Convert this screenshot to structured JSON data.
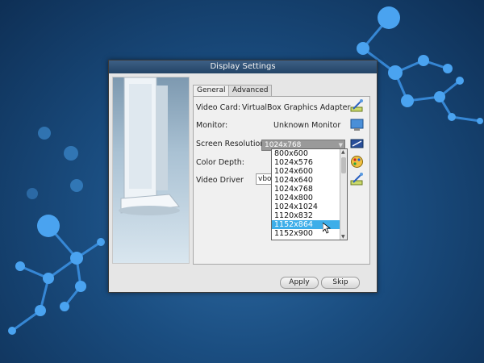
{
  "window": {
    "title": "Display Settings"
  },
  "tabs": [
    {
      "label": "General",
      "active": true
    },
    {
      "label": "Advanced",
      "active": false
    }
  ],
  "rows": {
    "video_card": {
      "label": "Video Card:",
      "value": "VirtualBox Graphics Adapter"
    },
    "monitor": {
      "label": "Monitor:",
      "value": "Unknown Monitor"
    },
    "resolution": {
      "label": "Screen Resolution:",
      "value": "1024x768"
    },
    "color_depth": {
      "label": "Color Depth:"
    },
    "video_driver": {
      "label": "Video Driver",
      "value_partial": "vbox"
    }
  },
  "resolution_options": [
    "800x600",
    "1024x576",
    "1024x600",
    "1024x640",
    "1024x768",
    "1024x800",
    "1024x1024",
    "1120x832",
    "1152x864",
    "1152x900"
  ],
  "resolution_highlighted": "1152x864",
  "buttons": {
    "apply": "Apply",
    "skip": "Skip"
  },
  "colors": {
    "title_bar": "#2d4f75",
    "selection": "#3daee9",
    "wallpaper": "#1a4d80"
  }
}
